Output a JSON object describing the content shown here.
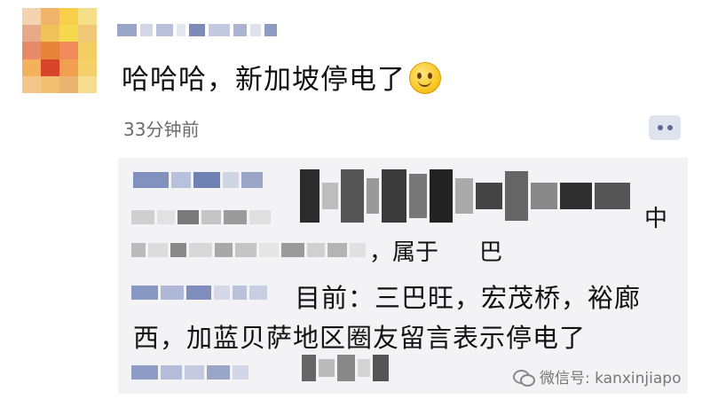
{
  "post": {
    "text": "哈哈哈，新加坡停电了",
    "emoji": "smiling-face-icon",
    "time": "33分钟前"
  },
  "comment": {
    "partial_fragment_1": "中",
    "partial_fragment_2": "，属于",
    "partial_fragment_3": "巴",
    "line1": "目前：三巴旺，宏茂桥，裕廊",
    "line2": "西，加蓝贝萨地区圈友留言表示停电了"
  },
  "watermark": {
    "text": "微信号: kanxinjiapo"
  },
  "colors": {
    "comment_bg": "#f3f3f5",
    "link_blue": "#576b95",
    "timestamp_gray": "#6b6b6b"
  }
}
